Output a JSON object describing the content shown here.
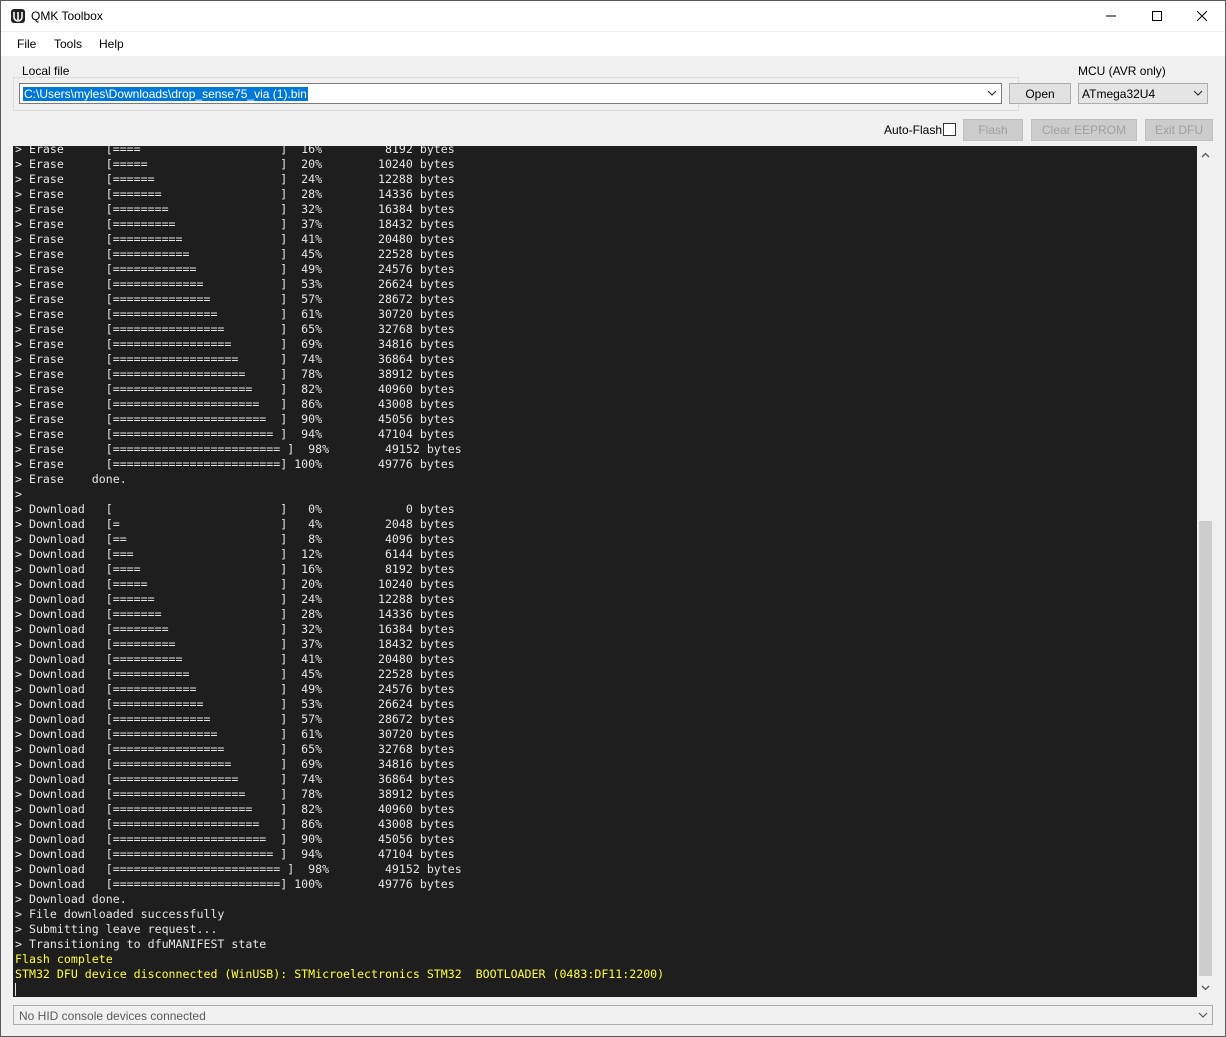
{
  "window": {
    "title": "QMK Toolbox"
  },
  "menu": [
    "File",
    "Tools",
    "Help"
  ],
  "local_file": {
    "label": "Local file",
    "path": "C:\\Users\\myles\\Downloads\\drop_sense75_via (1).bin",
    "open_label": "Open"
  },
  "mcu": {
    "label": "MCU (AVR only)",
    "value": "ATmega32U4"
  },
  "toolbar": {
    "auto_flash_label": "Auto-Flash",
    "flash_label": "Flash",
    "clear_eeprom_label": "Clear EEPROM",
    "exit_dfu_label": "Exit DFU"
  },
  "console": {
    "lines": [
      "> Erase      [====                    ]  16%         8192 bytes",
      "> Erase      [=====                   ]  20%        10240 bytes",
      "> Erase      [======                  ]  24%        12288 bytes",
      "> Erase      [=======                 ]  28%        14336 bytes",
      "> Erase      [========                ]  32%        16384 bytes",
      "> Erase      [=========               ]  37%        18432 bytes",
      "> Erase      [==========              ]  41%        20480 bytes",
      "> Erase      [===========             ]  45%        22528 bytes",
      "> Erase      [============            ]  49%        24576 bytes",
      "> Erase      [=============           ]  53%        26624 bytes",
      "> Erase      [==============          ]  57%        28672 bytes",
      "> Erase      [===============         ]  61%        30720 bytes",
      "> Erase      [================        ]  65%        32768 bytes",
      "> Erase      [=================       ]  69%        34816 bytes",
      "> Erase      [==================      ]  74%        36864 bytes",
      "> Erase      [===================     ]  78%        38912 bytes",
      "> Erase      [====================    ]  82%        40960 bytes",
      "> Erase      [=====================   ]  86%        43008 bytes",
      "> Erase      [======================  ]  90%        45056 bytes",
      "> Erase      [======================= ]  94%        47104 bytes",
      "> Erase      [======================== ]  98%        49152 bytes",
      "> Erase      [========================] 100%        49776 bytes",
      "> Erase    done.",
      ">",
      "> Download   [                        ]   0%            0 bytes",
      "> Download   [=                       ]   4%         2048 bytes",
      "> Download   [==                      ]   8%         4096 bytes",
      "> Download   [===                     ]  12%         6144 bytes",
      "> Download   [====                    ]  16%         8192 bytes",
      "> Download   [=====                   ]  20%        10240 bytes",
      "> Download   [======                  ]  24%        12288 bytes",
      "> Download   [=======                 ]  28%        14336 bytes",
      "> Download   [========                ]  32%        16384 bytes",
      "> Download   [=========               ]  37%        18432 bytes",
      "> Download   [==========              ]  41%        20480 bytes",
      "> Download   [===========             ]  45%        22528 bytes",
      "> Download   [============            ]  49%        24576 bytes",
      "> Download   [=============           ]  53%        26624 bytes",
      "> Download   [==============          ]  57%        28672 bytes",
      "> Download   [===============         ]  61%        30720 bytes",
      "> Download   [================        ]  65%        32768 bytes",
      "> Download   [=================       ]  69%        34816 bytes",
      "> Download   [==================      ]  74%        36864 bytes",
      "> Download   [===================     ]  78%        38912 bytes",
      "> Download   [====================    ]  82%        40960 bytes",
      "> Download   [=====================   ]  86%        43008 bytes",
      "> Download   [======================  ]  90%        45056 bytes",
      "> Download   [======================= ]  94%        47104 bytes",
      "> Download   [======================== ]  98%        49152 bytes",
      "> Download   [========================] 100%        49776 bytes",
      "> Download done.",
      "> File downloaded successfully",
      "> Submitting leave request...",
      "> Transitioning to dfuMANIFEST state",
      "Flash complete",
      "STM32 DFU device disconnected (WinUSB): STMicroelectronics STM32  BOOTLOADER (0483:DF11:2200)"
    ],
    "highlight_from": 54,
    "highlight_color": "#ffff3c"
  },
  "hid_console": {
    "value": "No HID console devices connected"
  }
}
